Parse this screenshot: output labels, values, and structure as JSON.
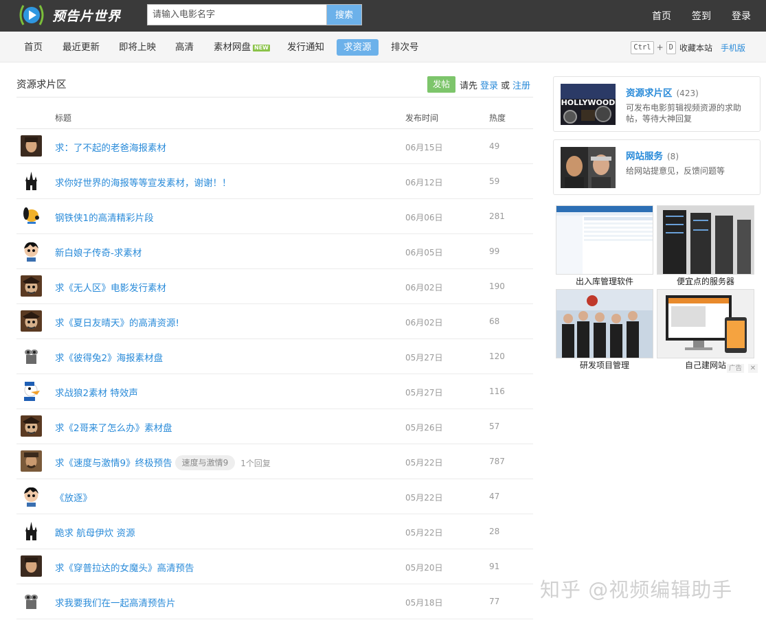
{
  "brand": {
    "name": "预告片世界"
  },
  "search": {
    "placeholder": "请输入电影名字",
    "button": "搜索"
  },
  "top_links": [
    "首页",
    "签到",
    "登录"
  ],
  "nav": {
    "items": [
      {
        "label": "首页"
      },
      {
        "label": "最近更新"
      },
      {
        "label": "即将上映"
      },
      {
        "label": "高清"
      },
      {
        "label": "素材网盘",
        "badge": "NEW"
      },
      {
        "label": "发行通知"
      },
      {
        "label": "求资源",
        "active": true
      },
      {
        "label": "排次号"
      }
    ],
    "shortcut_key1": "Ctrl",
    "shortcut_plus": "+",
    "shortcut_key2": "D",
    "favorite": "收藏本站",
    "mobile": "手机版"
  },
  "section": {
    "title": "资源求片区",
    "post_button": "发帖",
    "login_prompt_pre": "请先",
    "login": "登录",
    "or": "或",
    "register": "注册"
  },
  "columns": {
    "title": "标题",
    "date": "发布时间",
    "heat": "热度"
  },
  "rows": [
    {
      "title": "求：了不起的老爸海报素材",
      "date": "06月15日",
      "heat": "49",
      "avatar": "portrait"
    },
    {
      "title": "求你好世界的海报等等宣发素材，谢谢！！",
      "date": "06月12日",
      "heat": "59",
      "avatar": "castle"
    },
    {
      "title": "钢铁侠1的高清精彩片段",
      "date": "06月06日",
      "heat": "281",
      "avatar": "pluto"
    },
    {
      "title": "新白娘子传奇-求素材",
      "date": "06月05日",
      "heat": "99",
      "avatar": "astro"
    },
    {
      "title": "求《无人区》电影发行素材",
      "date": "06月02日",
      "heat": "190",
      "avatar": "pirate"
    },
    {
      "title": "求《夏日友晴天》的高清资源!",
      "date": "06月02日",
      "heat": "68",
      "avatar": "pirate"
    },
    {
      "title": "求《彼得兔2》海报素材盘",
      "date": "05月27日",
      "heat": "120",
      "avatar": "robot"
    },
    {
      "title": "求战狼2素材 特效声",
      "date": "05月27日",
      "heat": "116",
      "avatar": "donald"
    },
    {
      "title": "求《2哥来了怎么办》素材盘",
      "date": "05月26日",
      "heat": "57",
      "avatar": "pirate"
    },
    {
      "title": "求《速度与激情9》终极预告",
      "date": "05月22日",
      "heat": "787",
      "avatar": "jack",
      "tag": "速度与激情9",
      "replies": "1个回复"
    },
    {
      "title": "《放逐》",
      "date": "05月22日",
      "heat": "47",
      "avatar": "astro"
    },
    {
      "title": "跪求 航母伊炊 资源",
      "date": "05月22日",
      "heat": "28",
      "avatar": "castle"
    },
    {
      "title": "求《穿普拉达的女魔头》高清预告",
      "date": "05月20日",
      "heat": "91",
      "avatar": "portrait"
    },
    {
      "title": "求我要我们在一起高清预告片",
      "date": "05月18日",
      "heat": "77",
      "avatar": "robot"
    }
  ],
  "sidebar": {
    "cards": [
      {
        "title": "资源求片区",
        "count": "(423)",
        "desc": "可发布电影剪辑视频资源的求助帖，等待大神回复",
        "image_text": "HOLLYWOOD"
      },
      {
        "title": "网站服务",
        "count": "(8)",
        "desc": "给网站提意见，反馈问题等"
      }
    ],
    "ads": [
      {
        "label": "出入库管理软件"
      },
      {
        "label": "便宜点的服务器"
      },
      {
        "label": "研发项目管理"
      },
      {
        "label": "自己建网站"
      }
    ],
    "ad_mark": "广告",
    "ad_close": "✕"
  },
  "watermark": "知乎 @视频编辑助手"
}
